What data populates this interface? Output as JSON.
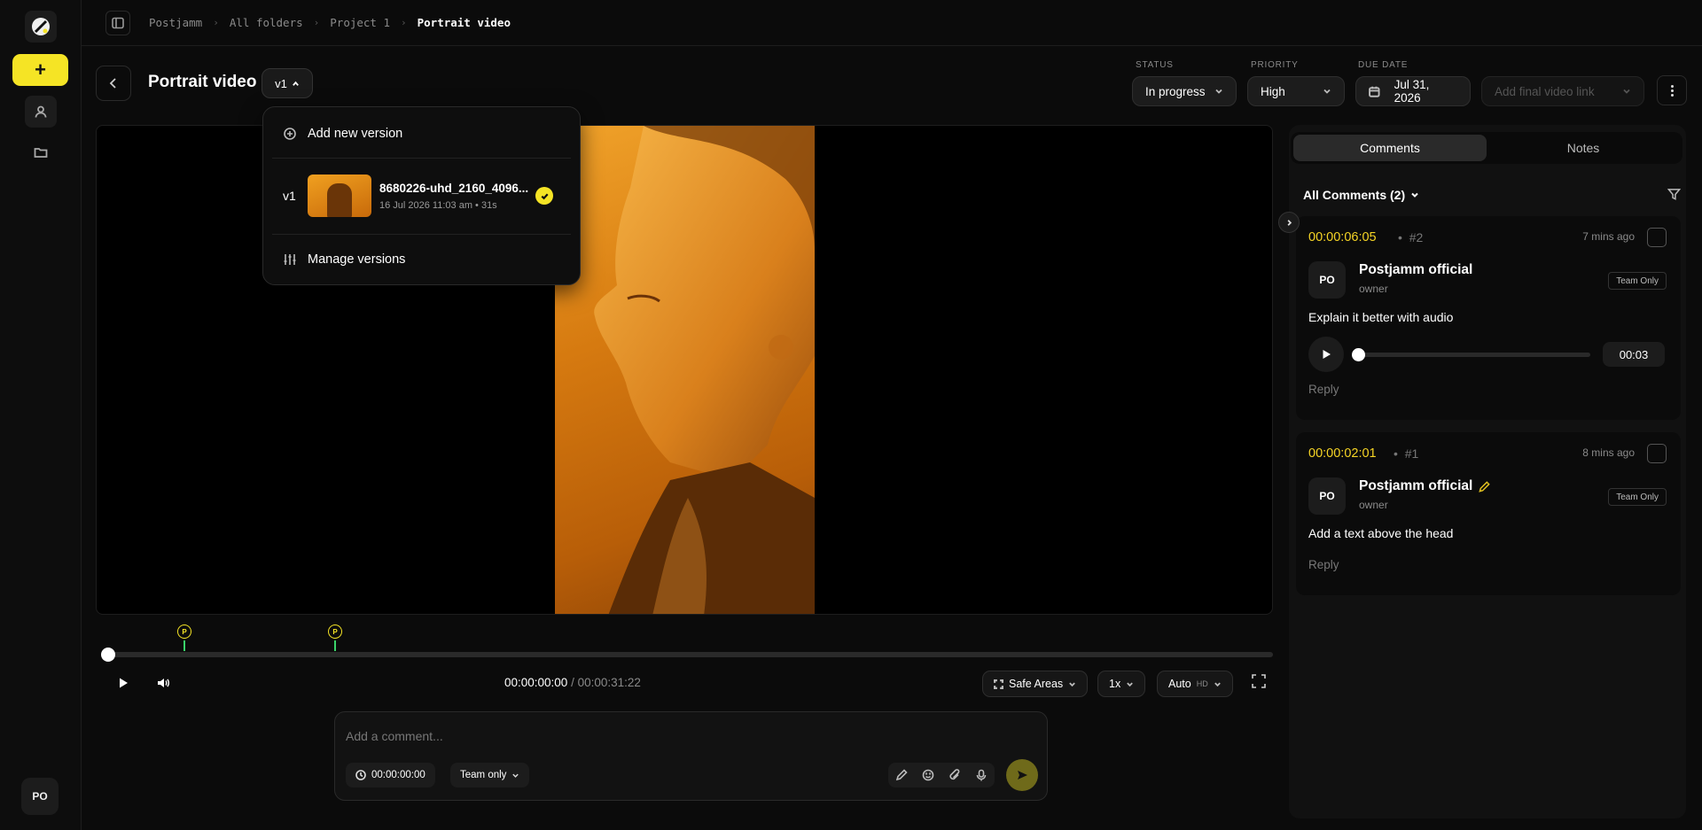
{
  "sidebar": {
    "new_label": "+",
    "avatar": "PO"
  },
  "breadcrumb": [
    "Postjamm",
    "All folders",
    "Project 1",
    "Portrait video"
  ],
  "header": {
    "title": "Portrait video",
    "version": "v1",
    "status_label": "STATUS",
    "status_value": "In progress",
    "priority_label": "PRIORITY",
    "priority_value": "High",
    "due_label": "DUE DATE",
    "due_value": "Jul 31, 2026",
    "final_link_placeholder": "Add final video link"
  },
  "version_menu": {
    "add_label": "Add new version",
    "version_tag": "v1",
    "file_name": "8680226-uhd_2160_4096...",
    "file_meta": "16 Jul 2026 11:03 am • 31s",
    "manage_label": "Manage versions"
  },
  "player": {
    "marker_label": "P",
    "current_time": "00:00:00:00",
    "total_time": " / 00:00:31:22",
    "safe_areas": "Safe Areas",
    "speed": "1x",
    "quality": "Auto",
    "quality_suffix": "HD"
  },
  "composer": {
    "placeholder": "Add a comment...",
    "timestamp": "00:00:00:00",
    "visibility": "Team only"
  },
  "panel": {
    "tabs": [
      "Comments",
      "Notes"
    ],
    "filter_label": "All Comments (2)",
    "comments": [
      {
        "time": "00:00:06:05",
        "num": "#2",
        "ago": "7 mins ago",
        "avatar": "PO",
        "name": "Postjamm official",
        "role": "owner",
        "badge": "Team Only",
        "text": "Explain it better with audio",
        "audio_duration": "00:03",
        "reply": "Reply"
      },
      {
        "time": "00:00:02:01",
        "num": "#1",
        "ago": "8 mins ago",
        "avatar": "PO",
        "name": "Postjamm official",
        "role": "owner",
        "badge": "Team Only",
        "text": "Add a text above the head",
        "reply": "Reply"
      }
    ]
  },
  "colors": {
    "accent": "#f5e425",
    "timecode": "#f5d425",
    "marker_line": "#3ad36a"
  }
}
